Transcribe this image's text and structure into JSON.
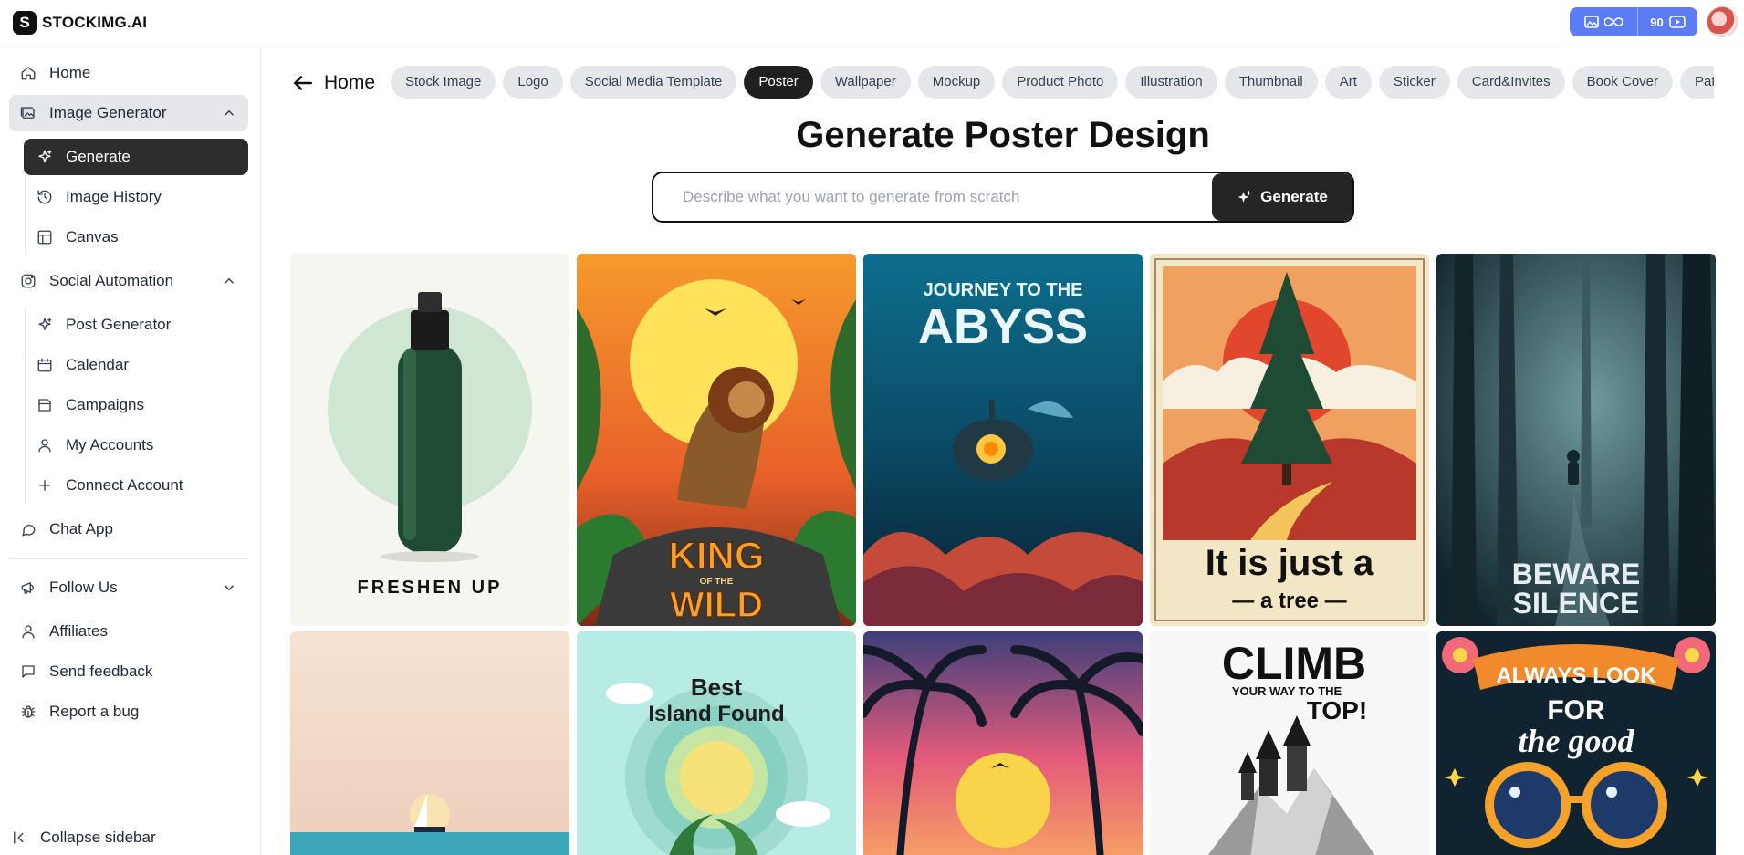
{
  "brand": {
    "name": "STOCKIMG.AI",
    "mark": "S"
  },
  "credits": {
    "count": "90"
  },
  "sidebar": {
    "home": "Home",
    "image_generator": {
      "label": "Image Generator",
      "items": [
        "Generate",
        "Image History",
        "Canvas"
      ]
    },
    "social_automation": {
      "label": "Social Automation",
      "items": [
        "Post Generator",
        "Calendar",
        "Campaigns",
        "My Accounts",
        "Connect Account"
      ]
    },
    "chat_app": "Chat App",
    "follow_us": "Follow Us",
    "affiliates": "Affiliates",
    "send_feedback": "Send feedback",
    "report_bug": "Report a bug",
    "collapse": "Collapse sidebar"
  },
  "main": {
    "back_label": "Home",
    "categories": [
      "Stock Image",
      "Logo",
      "Social Media Template",
      "Poster",
      "Wallpaper",
      "Mockup",
      "Product Photo",
      "Illustration",
      "Thumbnail",
      "Art",
      "Sticker",
      "Card&Invites",
      "Book Cover",
      "Pattern"
    ],
    "active_category": "Poster",
    "headline": "Generate Poster Design",
    "prompt_placeholder": "Describe what you want to generate from scratch",
    "generate_label": "Generate",
    "gallery": [
      {
        "name": "freshen-up-poster",
        "lines": [
          "FRESHEN UP"
        ]
      },
      {
        "name": "king-of-the-wild-poster",
        "lines": [
          "KING",
          "OF THE",
          "WILD"
        ]
      },
      {
        "name": "journey-to-the-abyss-poster",
        "lines": [
          "JOURNEY TO THE",
          "ABYSS"
        ]
      },
      {
        "name": "just-a-tree-poster",
        "lines": [
          "It is just a",
          "— a tree —"
        ]
      },
      {
        "name": "beware-silence-poster",
        "lines": [
          "BEWARE",
          "SILENCE"
        ]
      },
      {
        "name": "sailboat-sunset-poster",
        "lines": []
      },
      {
        "name": "best-island-found-poster",
        "lines": [
          "Best",
          "Island Found"
        ]
      },
      {
        "name": "palm-sunset-poster",
        "lines": []
      },
      {
        "name": "climb-to-the-top-poster",
        "lines": [
          "CLIMB",
          "YOUR WAY TO THE",
          "TOP!"
        ]
      },
      {
        "name": "always-look-for-the-good-poster",
        "lines": [
          "ALWAYS LOOK",
          "FOR",
          "the good"
        ]
      }
    ]
  }
}
